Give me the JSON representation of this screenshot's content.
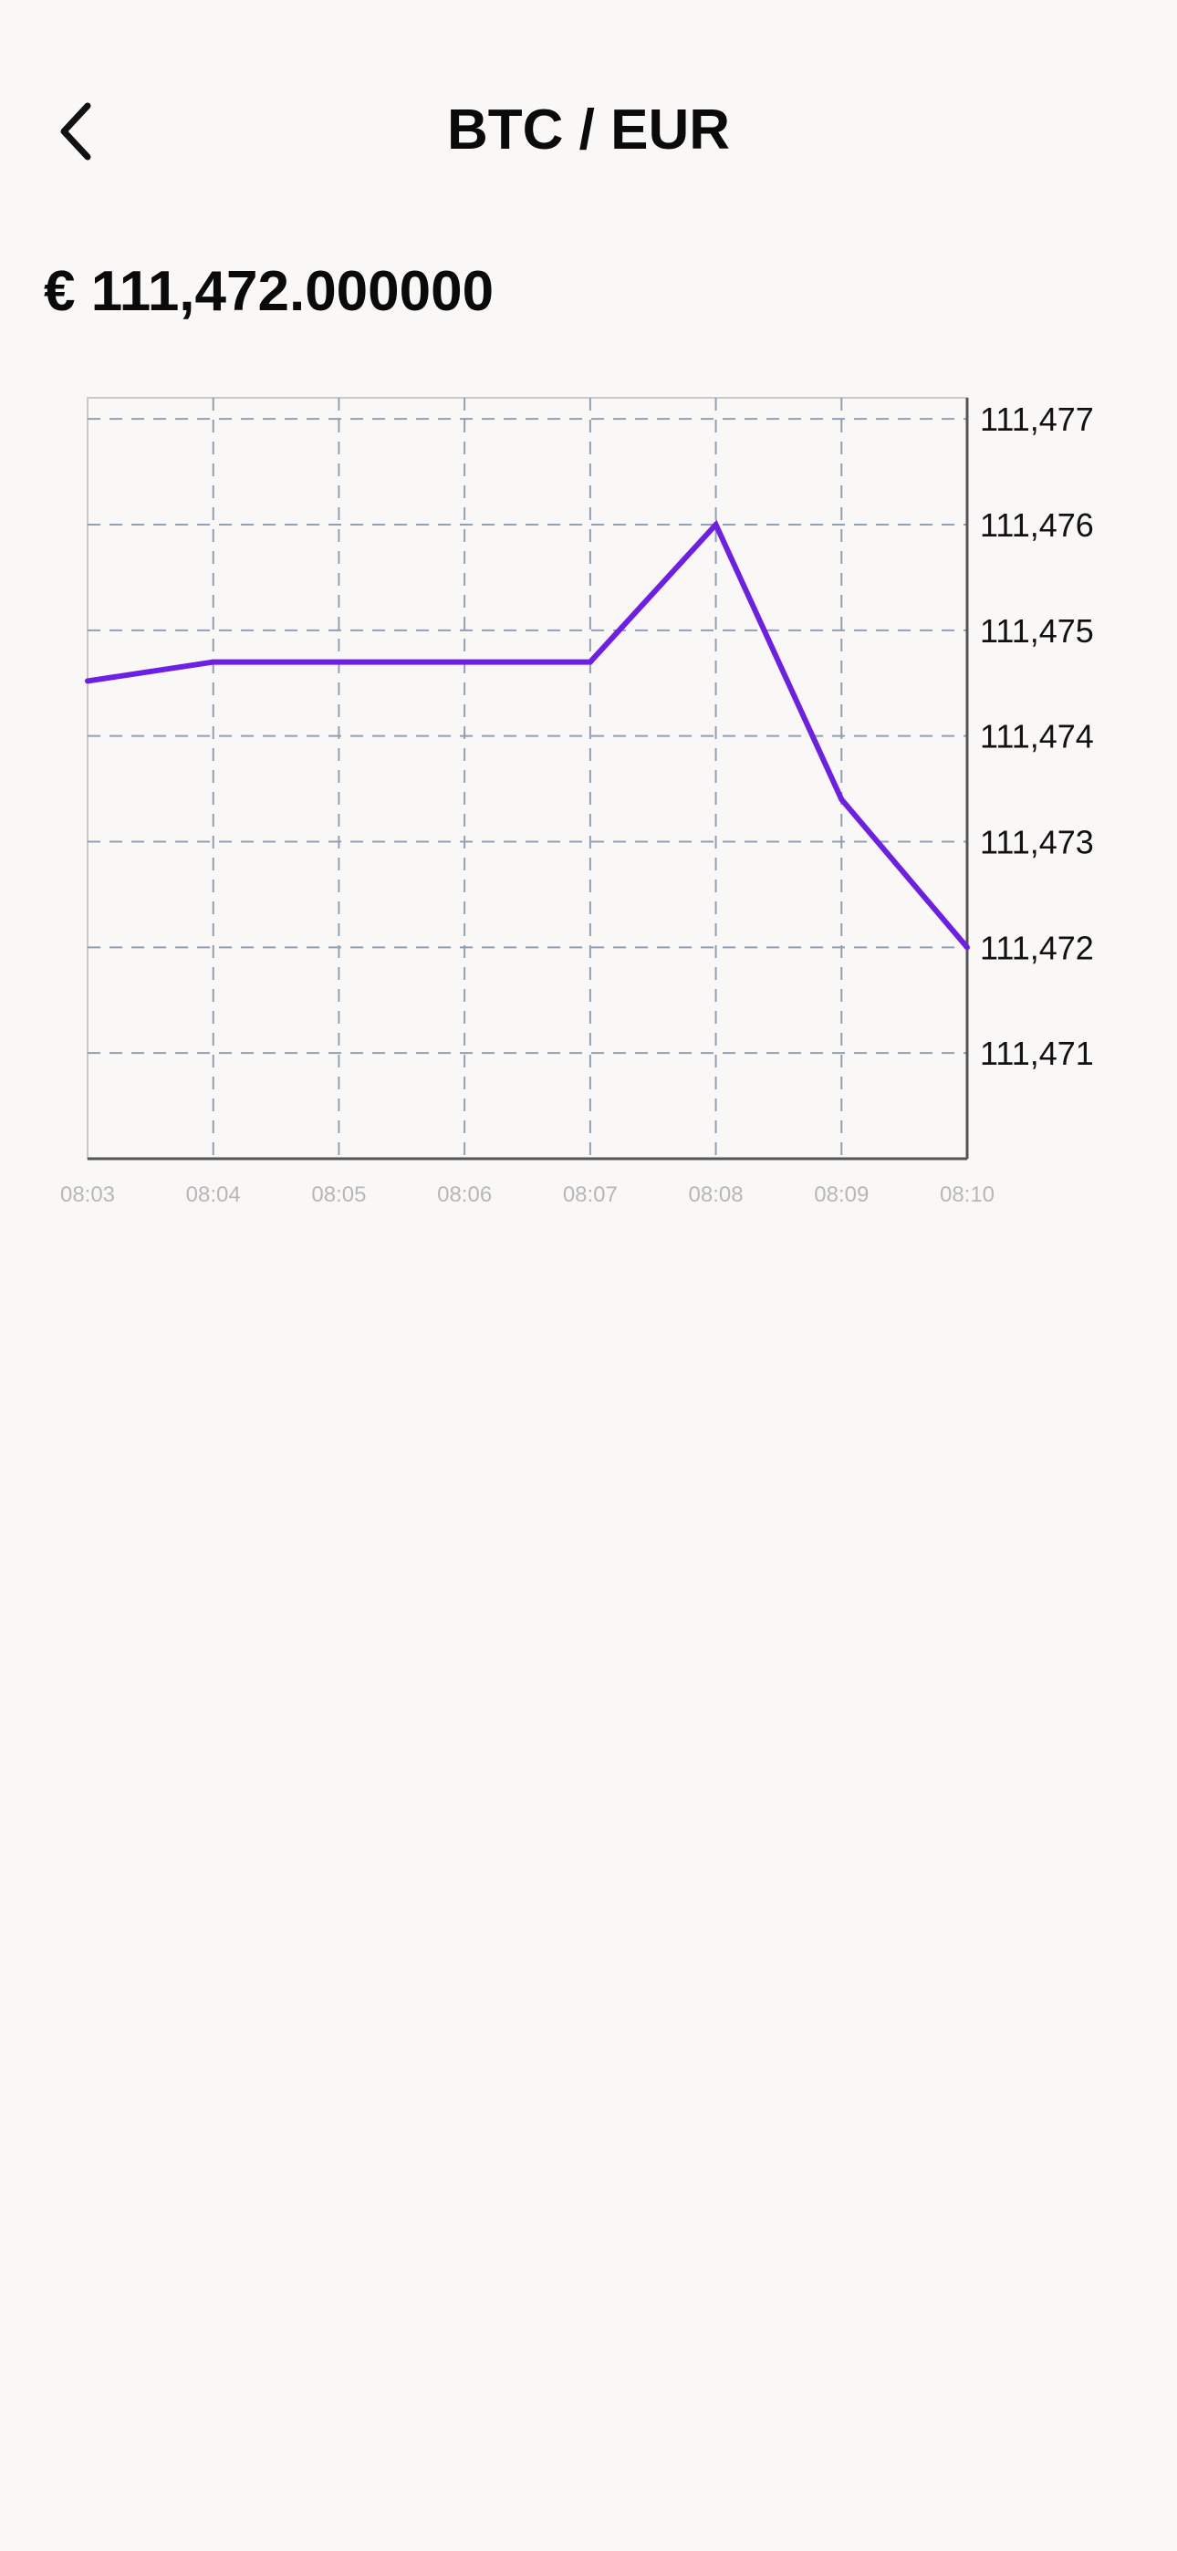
{
  "header": {
    "title": "BTC / EUR",
    "back_icon": "chevron-left-icon"
  },
  "price": {
    "display": "€ 111,472.000000"
  },
  "colors": {
    "background": "#f9f8f7",
    "line": "#6d1fe6",
    "grid": "#8fa0b4",
    "x_tick_text": "#b7b7b7"
  },
  "chart_data": {
    "type": "line",
    "title": "",
    "xlabel": "",
    "ylabel": "",
    "x_ticks": [
      "08:03",
      "08:04",
      "08:05",
      "08:06",
      "08:07",
      "08:08",
      "08:09",
      "08:10"
    ],
    "y_ticks": [
      "111,471",
      "111,472",
      "111,473",
      "111,474",
      "111,475",
      "111,476",
      "111,477"
    ],
    "ylim": [
      110,
      117.2
    ],
    "y_axis_position": "right",
    "grid": true,
    "series": [
      {
        "x": [
          "08:03",
          "08:04",
          "08:05",
          "08:06",
          "08:07",
          "08:08",
          "08:09",
          "08:10"
        ],
        "values": [
          111474.52,
          111474.7,
          111474.7,
          111474.7,
          111474.7,
          111476.0,
          111473.4,
          111472.0
        ]
      }
    ]
  }
}
